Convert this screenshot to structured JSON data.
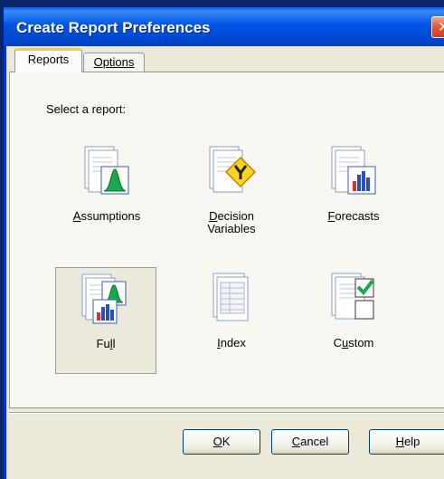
{
  "window": {
    "title": "Create Report Preferences",
    "close_glyph": "✕"
  },
  "tabs": [
    {
      "label": "Reports",
      "active": true
    },
    {
      "label": "Options",
      "active": false
    }
  ],
  "panel": {
    "prompt": "Select a report:"
  },
  "reports": [
    {
      "name": "assumptions",
      "label_first": "A",
      "label_rest": "ssumptions",
      "label_line2": "",
      "icon": "assumptions-report-icon",
      "selected": false
    },
    {
      "name": "decision-variables",
      "label_first": "D",
      "label_rest": "ecision",
      "label_line2": "Variables",
      "icon": "decision-variables-report-icon",
      "selected": false
    },
    {
      "name": "forecasts",
      "label_first": "F",
      "label_rest": "orecasts",
      "label_line2": "",
      "icon": "forecasts-report-icon",
      "selected": false
    },
    {
      "name": "full",
      "label_pre": "Fu",
      "label_u": "l",
      "label_post": "l",
      "icon": "full-report-icon",
      "selected": true
    },
    {
      "name": "index",
      "label_first": "I",
      "label_rest": "ndex",
      "label_line2": "",
      "icon": "index-report-icon",
      "selected": false
    },
    {
      "name": "custom",
      "label_pre": "C",
      "label_u": "u",
      "label_post": "stom",
      "icon": "custom-report-icon",
      "selected": false
    }
  ],
  "buttons": {
    "ok": {
      "u": "O",
      "rest": "K"
    },
    "cancel": {
      "u": "C",
      "rest": "ancel"
    },
    "help": {
      "u": "H",
      "rest": "elp"
    }
  },
  "colors": {
    "title_bar": "#0054e3",
    "dialog_bg": "#ece9d8",
    "tab_highlight": "#ffc83c",
    "close_button": "#e2582f"
  }
}
